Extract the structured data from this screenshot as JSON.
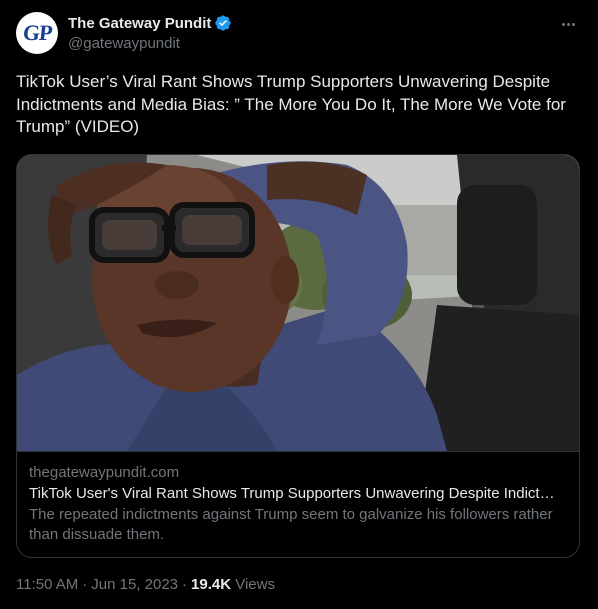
{
  "author": {
    "display_name": "The Gateway Pundit",
    "handle": "@gatewaypundit",
    "avatar_text": "GP",
    "verified": true
  },
  "tweet": {
    "text": "TikTok User’s Viral Rant Shows Trump Supporters Unwavering Despite Indictments and Media Bias: ” The More You Do It, The More We Vote for Trump” (VIDEO)"
  },
  "card": {
    "domain": "thegatewaypundit.com",
    "title": "TikTok User's Viral Rant Shows Trump Supporters Unwavering Despite Indictments and Media Bias",
    "description": "The repeated indictments against Trump seem to galvanize his followers rather than dissuade them."
  },
  "meta": {
    "time": "11:50 AM",
    "separator": "·",
    "date": "Jun 15, 2023",
    "views_count": "19.4K",
    "views_label": "Views"
  },
  "icons": {
    "verified": "verified-badge-icon",
    "more": "more-options-icon"
  },
  "colors": {
    "background": "#000000",
    "text_primary": "#e7e9ea",
    "text_secondary": "#71767b",
    "border": "#2f3336",
    "verified_blue": "#1d9bf0",
    "avatar_brand": "#1b3f8f"
  }
}
